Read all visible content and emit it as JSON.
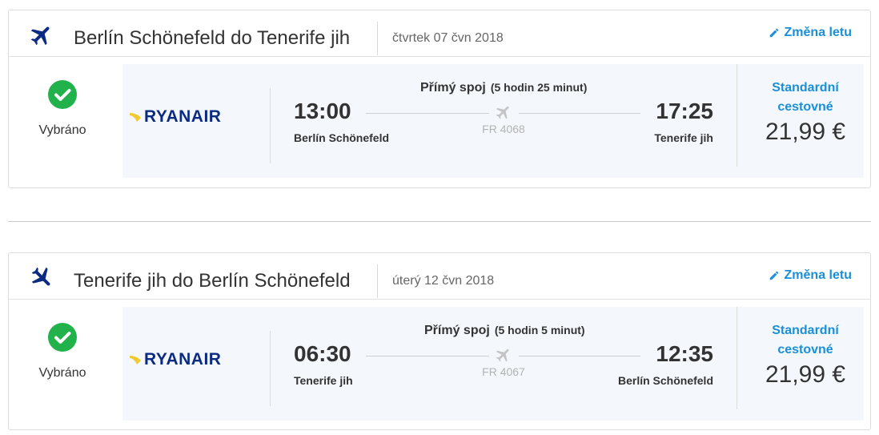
{
  "flights": [
    {
      "title": "Berlín Schönefeld do Tenerife jih",
      "date": "čtvrtek 07 čvn 2018",
      "change_label": "Změna letu",
      "selected_label": "Vybráno",
      "airline": "RYANAIR",
      "direct_label": "Přímý spoj",
      "duration": "(5 hodin 25 minut)",
      "dep_time": "13:00",
      "dep_place": "Berlín Schönefeld",
      "arr_time": "17:25",
      "arr_place": "Tenerife jih",
      "flight_number": "FR 4068",
      "fare_name_1": "Standardní",
      "fare_name_2": "cestovné",
      "price": "21,99 €"
    },
    {
      "title": "Tenerife jih do Berlín Schönefeld",
      "date": "úterý 12 čvn 2018",
      "change_label": "Změna letu",
      "selected_label": "Vybráno",
      "airline": "RYANAIR",
      "direct_label": "Přímý spoj",
      "duration": "(5 hodin 5 minut)",
      "dep_time": "06:30",
      "dep_place": "Tenerife jih",
      "arr_time": "12:35",
      "arr_place": "Berlín Schönefeld",
      "flight_number": "FR 4067",
      "fare_name_1": "Standardní",
      "fare_name_2": "cestovné",
      "price": "21,99 €"
    }
  ],
  "colors": {
    "accent": "#1a8fd8",
    "success": "#22b24c",
    "brand": "#0b2b82",
    "panel": "#f4f8fc"
  },
  "icons": {
    "header": "airplane-icon",
    "selected": "check-icon",
    "edit": "pencil-icon",
    "route": "airplane-icon"
  }
}
